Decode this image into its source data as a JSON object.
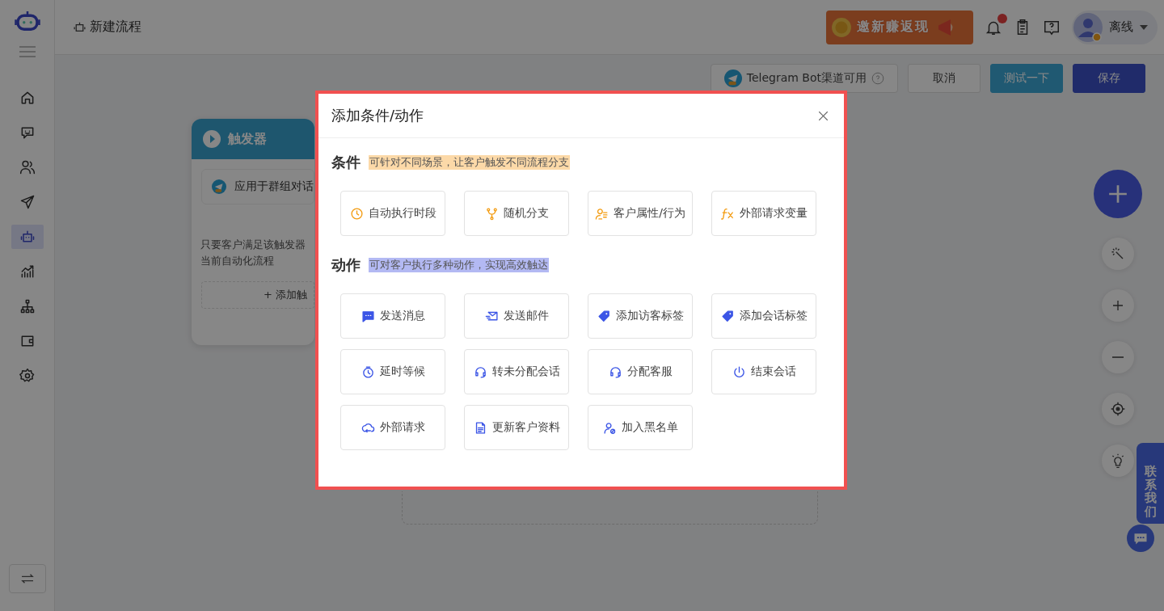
{
  "sidebar": {
    "items": [
      {
        "selected": false
      },
      {
        "selected": false
      },
      {
        "selected": false
      },
      {
        "selected": false
      },
      {
        "selected": true
      },
      {
        "selected": false
      },
      {
        "selected": false
      },
      {
        "selected": false
      },
      {
        "selected": false
      }
    ]
  },
  "header": {
    "title": "新建流程",
    "promo": "邀新赚返现",
    "user_status": "离线"
  },
  "toolbar": {
    "channel": "Telegram Bot渠道可用",
    "buttons": [
      {
        "label": "取消",
        "kind": "plain"
      },
      {
        "label": "测试一下",
        "kind": "test"
      },
      {
        "label": "保存",
        "kind": "primary"
      }
    ]
  },
  "trigger_card": {
    "title": "触发器",
    "channel": "应用于群组对话",
    "description": [
      "只要客户满足该触发器",
      "当前自动化流程"
    ],
    "add_button": "+ 添加触"
  },
  "contact": "联系我们",
  "modal": {
    "title": "添加条件/动作",
    "sections": [
      {
        "kind": "condition",
        "heading": "条件",
        "hint": "可针对不同场景，让客户触发不同流程分支",
        "color": "#fcd9a8",
        "items": [
          {
            "label": "自动执行时段"
          },
          {
            "label": "随机分支"
          },
          {
            "label": "客户属性/行为"
          },
          {
            "label": "外部请求变量"
          }
        ]
      },
      {
        "kind": "action",
        "heading": "动作",
        "hint": "可对客户执行多种动作，实现高效触达",
        "color": "#b3b9f3",
        "items": [
          {
            "label": "发送消息"
          },
          {
            "label": "发送邮件"
          },
          {
            "label": "添加访客标签"
          },
          {
            "label": "添加会话标签"
          },
          {
            "label": "延时等候"
          },
          {
            "label": "转未分配会话"
          },
          {
            "label": "分配客服"
          },
          {
            "label": "结束会话"
          },
          {
            "label": "外部请求"
          },
          {
            "label": "更新客户资料"
          },
          {
            "label": "加入黑名单"
          }
        ]
      }
    ]
  }
}
